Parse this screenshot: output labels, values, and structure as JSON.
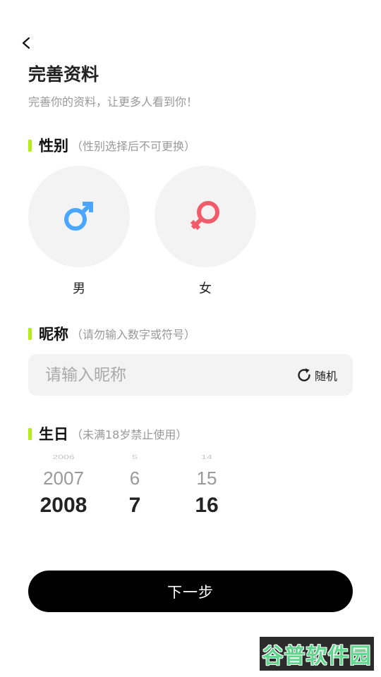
{
  "header": {
    "title": "完善资料",
    "subtitle": "完善你的资料，让更多人看到你！"
  },
  "gender": {
    "title": "性别",
    "hint": "（性别选择后不可更换）",
    "options": [
      {
        "label": "男",
        "icon": "male-symbol-icon",
        "color": "#4aa6ff"
      },
      {
        "label": "女",
        "icon": "female-symbol-icon",
        "color": "#f25c6a"
      }
    ]
  },
  "nickname": {
    "title": "昵称",
    "hint": "（请勿输入数字或符号）",
    "placeholder": "请输入昵称",
    "value": "",
    "random_label": "随机"
  },
  "birthday": {
    "title": "生日",
    "hint": "（未满18岁禁止使用）",
    "year": {
      "far": "2006",
      "near": "2007",
      "selected": "2008"
    },
    "month": {
      "far": "5",
      "near": "6",
      "selected": "7"
    },
    "day": {
      "far": "14",
      "near": "15",
      "selected": "16"
    }
  },
  "footer": {
    "next_label": "下一步"
  },
  "watermark": {
    "text": "谷普软件园"
  },
  "colors": {
    "accent": "#b6ec1c",
    "male": "#4aa6ff",
    "female": "#f25c6a",
    "button": "#000000"
  }
}
